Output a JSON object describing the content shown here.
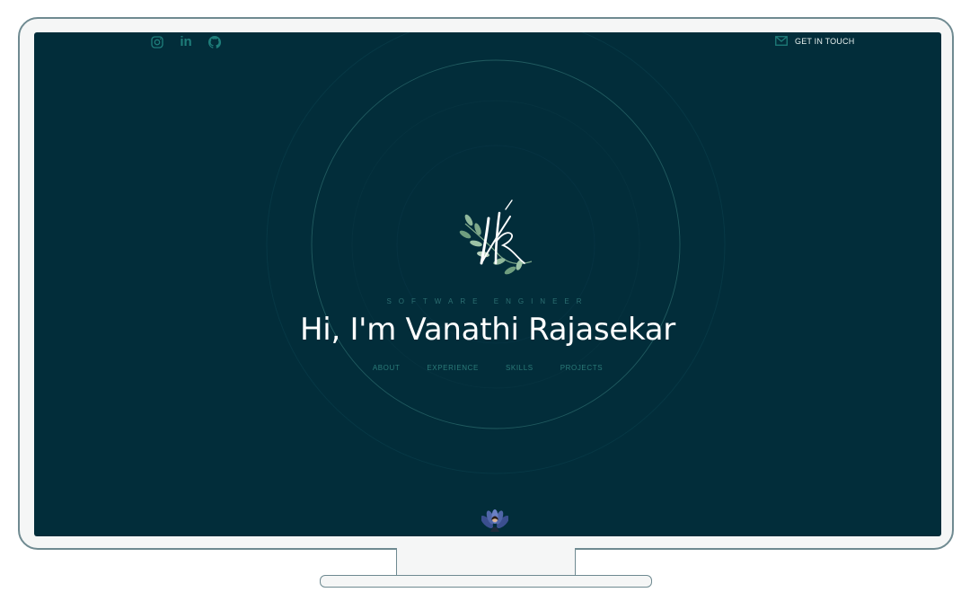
{
  "header": {
    "social_icons": [
      {
        "icon": "instagram-icon"
      },
      {
        "icon": "linkedin-icon",
        "glyph": "in"
      },
      {
        "icon": "github-icon"
      }
    ],
    "contact": {
      "icon": "mail-icon",
      "label": "GET IN TOUCH"
    }
  },
  "hero": {
    "logo_icon": "monogram-leaf-logo",
    "tagline": "SOFTWARE ENGINEER",
    "headline": "Hi, I'm Vanathi Rajasekar",
    "nav": [
      {
        "label": "ABOUT"
      },
      {
        "label": "EXPERIENCE"
      },
      {
        "label": "SKILLS"
      },
      {
        "label": "PROJECTS"
      }
    ]
  },
  "footer": {
    "avatar_icon": "profile-avatar-icon"
  },
  "colors": {
    "background": "#022d3a",
    "accent": "#1e7d7a",
    "text": "#ffffff",
    "frame": "#6f8a91"
  }
}
